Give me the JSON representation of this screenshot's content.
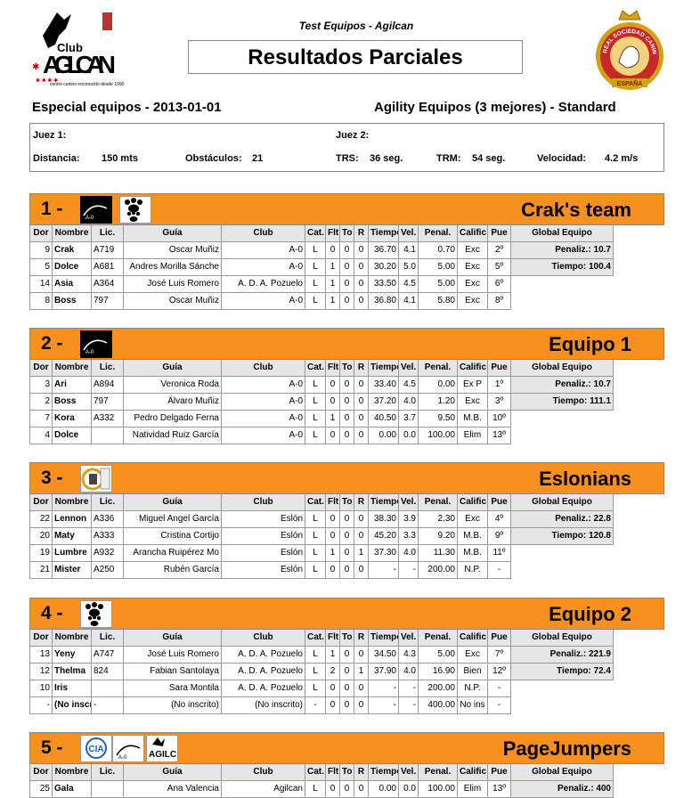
{
  "header": {
    "logo_text": {
      "club": "Club",
      "name": "AGILCAN",
      "tagline": "centro canino reconocido desde 1990"
    },
    "subtitle": "Test Equipos - Agilcan",
    "title": "Resultados Parciales",
    "left_heading": "Especial equipos - 2013-01-01",
    "right_heading": "Agility Equipos (3 mejores) - Standard",
    "seal_text": {
      "top": "REAL SOCIEDAD CANINA",
      "bottom": "ESPAÑA"
    }
  },
  "judges": {
    "juez1_label": "Juez 1:",
    "juez1_value": "",
    "juez2_label": "Juez 2:",
    "juez2_value": "",
    "distancia_label": "Distancia:",
    "distancia_value": "150 mts",
    "obstaculos_label": "Obstáculos:",
    "obstaculos_value": "21",
    "trs_label": "TRS:",
    "trs_value": "36 seg.",
    "trm_label": "TRM:",
    "trm_value": "54 seg.",
    "velocidad_label": "Velocidad:",
    "velocidad_value": "4.2 m/s"
  },
  "columns": [
    "Dor",
    "Nombre",
    "Lic.",
    "Guía",
    "Club",
    "Cat.",
    "Flt",
    "To",
    "R",
    "Tiempo",
    "Vel.",
    "Penal.",
    "Calific",
    "Pue",
    "Global Equipo"
  ],
  "colors": {
    "team_bar": "#f7901e",
    "header_bg": "#e6e6e6"
  },
  "teams": [
    {
      "rank": "1 -",
      "name": "Crak's team",
      "logos": [
        "club-agilcan-dark-icon",
        "paw-prints-icon"
      ],
      "penaliz": "Penaliz.: 10.7",
      "tiempo": "Tiempo: 100.4",
      "rows": [
        [
          "9",
          "Crak",
          "A719",
          "Oscar Muñiz",
          "A-0",
          "L",
          "0",
          "0",
          "0",
          "36.70",
          "4.1",
          "0.70",
          "Exc",
          "2º"
        ],
        [
          "5",
          "Dolce",
          "A681",
          "Andres Morilla Sánche",
          "A-0",
          "L",
          "1",
          "0",
          "0",
          "30.20",
          "5.0",
          "5.00",
          "Exc",
          "5º"
        ],
        [
          "14",
          "Asia",
          "A364",
          "José Luis Romero",
          "A. D. A. Pozuelo",
          "L",
          "1",
          "0",
          "0",
          "33.50",
          "4.5",
          "5.00",
          "Exc",
          "6º"
        ],
        [
          "8",
          "Boss",
          "797",
          "Oscar Muñiz",
          "A-0",
          "L",
          "1",
          "0",
          "0",
          "36.80",
          "4.1",
          "5.80",
          "Exc",
          "8º"
        ]
      ]
    },
    {
      "rank": "2 -",
      "name": "Equipo 1",
      "logos": [
        "club-agilcan-dark-icon"
      ],
      "penaliz": "Penaliz.: 10.7",
      "tiempo": "Tiempo: 111.1",
      "rows": [
        [
          "3",
          "Ari",
          "A894",
          "Veronica Roda",
          "A-0",
          "L",
          "0",
          "0",
          "0",
          "33.40",
          "4.5",
          "0.00",
          "Ex P",
          "1º"
        ],
        [
          "2",
          "Boss",
          "797",
          "Álvaro Muñiz",
          "A-0",
          "L",
          "0",
          "0",
          "0",
          "37.20",
          "4.0",
          "1.20",
          "Exc",
          "3º"
        ],
        [
          "7",
          "Kora",
          "A332",
          "Pedro Delgado Ferna",
          "A-0",
          "L",
          "1",
          "0",
          "0",
          "40.50",
          "3.7",
          "9.50",
          "M.B.",
          "10º"
        ],
        [
          "4",
          "Dolce",
          "",
          "Natividad Ruiz García",
          "A-0",
          "L",
          "0",
          "0",
          "0",
          "0.00",
          "0.0",
          "100.00",
          "Elim",
          "13º"
        ]
      ]
    },
    {
      "rank": "3 -",
      "name": "Eslonians",
      "logos": [
        "eslon-club-icon"
      ],
      "penaliz": "Penaliz.: 22.8",
      "tiempo": "Tiempo: 120.8",
      "rows": [
        [
          "22",
          "Lennon",
          "A336",
          "Miguel Angel García",
          "Eslón",
          "L",
          "0",
          "0",
          "0",
          "38.30",
          "3.9",
          "2.30",
          "Exc",
          "4º"
        ],
        [
          "20",
          "Maty",
          "A333",
          "Cristina Cortijo",
          "Eslón",
          "L",
          "0",
          "0",
          "0",
          "45.20",
          "3.3",
          "9.20",
          "M.B.",
          "9º"
        ],
        [
          "19",
          "Lumbre",
          "A932",
          "Arancha Ruipérez Mo",
          "Eslón",
          "L",
          "1",
          "0",
          "1",
          "37.30",
          "4.0",
          "11.30",
          "M.B.",
          "11º"
        ],
        [
          "21",
          "Mister",
          "A250",
          "Rubén García",
          "Eslón",
          "L",
          "0",
          "0",
          "0",
          "-",
          "-",
          "200.00",
          "N.P.",
          "-"
        ]
      ]
    },
    {
      "rank": "4 -",
      "name": "Equipo 2",
      "logos": [
        "paw-prints-icon"
      ],
      "penaliz": "Penaliz.: 221.9",
      "tiempo": "Tiempo: 72.4",
      "rows": [
        [
          "13",
          "Yeny",
          "A747",
          "José Luis Romero",
          "A. D. A. Pozuelo",
          "L",
          "1",
          "0",
          "0",
          "34.50",
          "4.3",
          "5.00",
          "Exc",
          "7º"
        ],
        [
          "12",
          "Thelma",
          "824",
          "Fabian Santolaya",
          "A. D. A. Pozuelo",
          "L",
          "2",
          "0",
          "1",
          "37.90",
          "4.0",
          "16.90",
          "Bien",
          "12º"
        ],
        [
          "10",
          "Iris",
          "",
          "Sara Montila",
          "A. D. A. Pozuelo",
          "L",
          "0",
          "0",
          "0",
          "-",
          "-",
          "200.00",
          "N.P.",
          "-"
        ],
        [
          "-",
          "(No inscrito",
          "-",
          "(No inscrito)",
          "(No inscrito)",
          "-",
          "0",
          "0",
          "0",
          "-",
          "-",
          "400.00",
          "No ins",
          "-"
        ]
      ]
    },
    {
      "rank": "5 -",
      "name": "PageJumpers",
      "logos": [
        "cia-club-icon",
        "club-agilcan-light-icon",
        "agilcan-logo-icon"
      ],
      "penaliz": "Penaliz.: 400",
      "tiempo": "",
      "rows": [
        [
          "25",
          "Gala",
          "",
          "Ana Valencia",
          "Agilcan",
          "L",
          "0",
          "0",
          "0",
          "0.00",
          "0.0",
          "100.00",
          "Elim",
          "13º"
        ]
      ]
    }
  ]
}
